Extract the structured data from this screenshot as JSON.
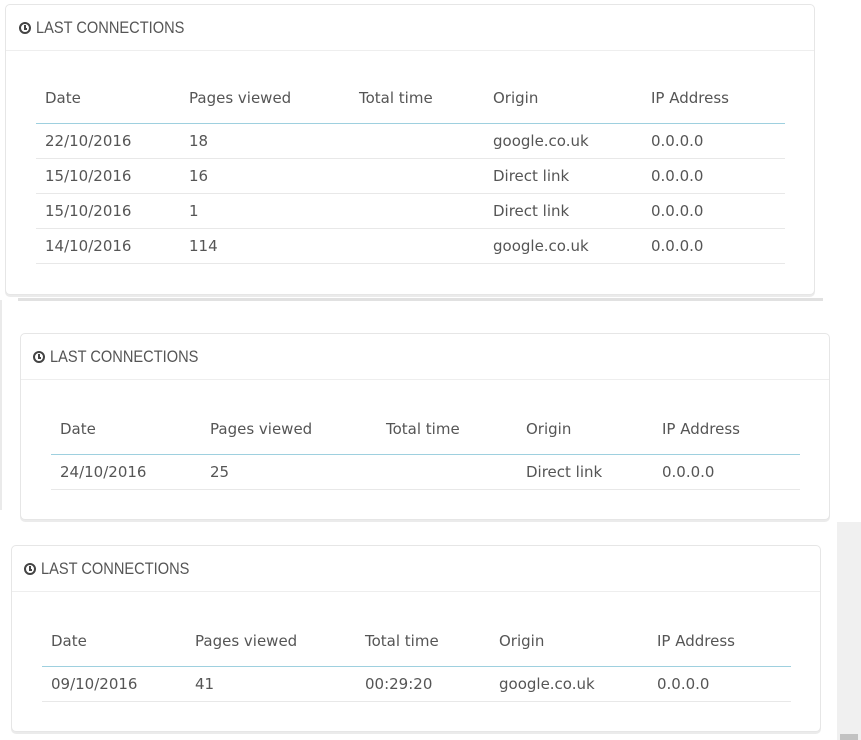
{
  "panels": [
    {
      "title": "LAST CONNECTIONS",
      "columns": [
        "Date",
        "Pages viewed",
        "Total time",
        "Origin",
        "IP Address"
      ],
      "rows": [
        [
          "22/10/2016",
          "18",
          "",
          "google.co.uk",
          "0.0.0.0"
        ],
        [
          "15/10/2016",
          "16",
          "",
          "Direct link",
          "0.0.0.0"
        ],
        [
          "15/10/2016",
          "1",
          "",
          "Direct link",
          "0.0.0.0"
        ],
        [
          "14/10/2016",
          "114",
          "",
          "google.co.uk",
          "0.0.0.0"
        ]
      ]
    },
    {
      "title": "LAST CONNECTIONS",
      "columns": [
        "Date",
        "Pages viewed",
        "Total time",
        "Origin",
        "IP Address"
      ],
      "rows": [
        [
          "24/10/2016",
          "25",
          "",
          "Direct link",
          "0.0.0.0"
        ]
      ]
    },
    {
      "title": "LAST CONNECTIONS",
      "columns": [
        "Date",
        "Pages viewed",
        "Total time",
        "Origin",
        "IP Address"
      ],
      "rows": [
        [
          "09/10/2016",
          "41",
          "00:29:20",
          "google.co.uk",
          "0.0.0.0"
        ]
      ]
    }
  ],
  "icon": "clock-icon",
  "colors": {
    "header_rule": "#9ed0df",
    "row_rule": "#e8e8e8",
    "text": "#555555"
  }
}
